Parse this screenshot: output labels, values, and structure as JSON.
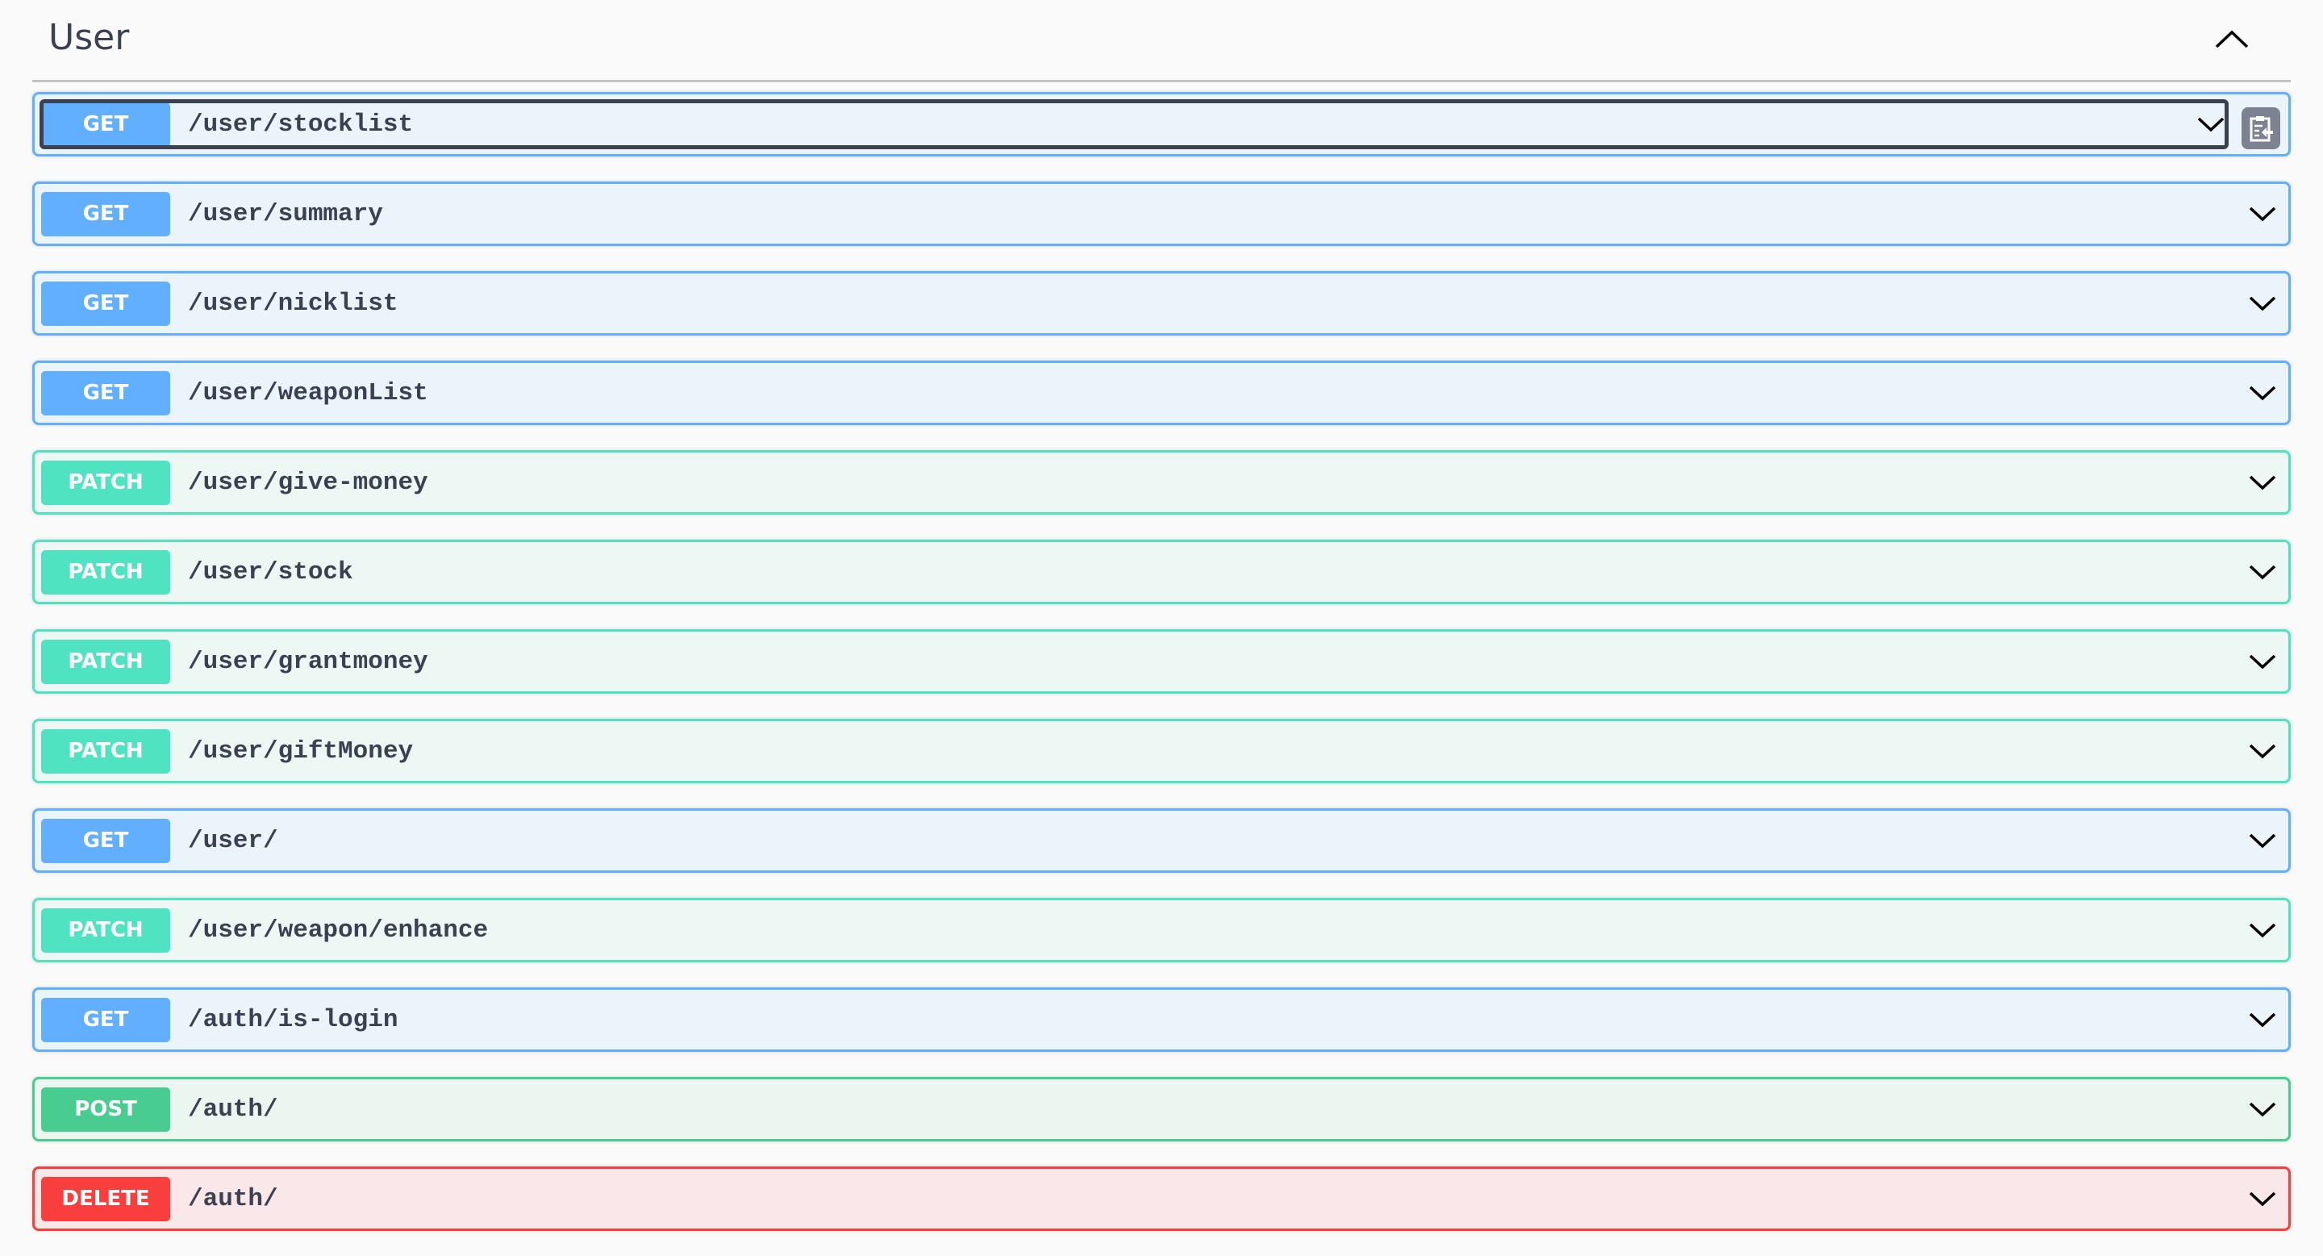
{
  "section": {
    "title": "User"
  },
  "operations": [
    {
      "method": "GET",
      "path": "/user/stocklist"
    },
    {
      "method": "GET",
      "path": "/user/summary"
    },
    {
      "method": "GET",
      "path": "/user/nicklist"
    },
    {
      "method": "GET",
      "path": "/user/weaponList"
    },
    {
      "method": "PATCH",
      "path": "/user/give-money"
    },
    {
      "method": "PATCH",
      "path": "/user/stock"
    },
    {
      "method": "PATCH",
      "path": "/user/grantmoney"
    },
    {
      "method": "PATCH",
      "path": "/user/giftMoney"
    },
    {
      "method": "GET",
      "path": "/user/"
    },
    {
      "method": "PATCH",
      "path": "/user/weapon/enhance"
    },
    {
      "method": "GET",
      "path": "/auth/is-login"
    },
    {
      "method": "POST",
      "path": "/auth/"
    },
    {
      "method": "DELETE",
      "path": "/auth/"
    }
  ],
  "colors": {
    "get": "#61affe",
    "patch": "#50e3c2",
    "post": "#49cc90",
    "delete": "#f93e3e"
  }
}
